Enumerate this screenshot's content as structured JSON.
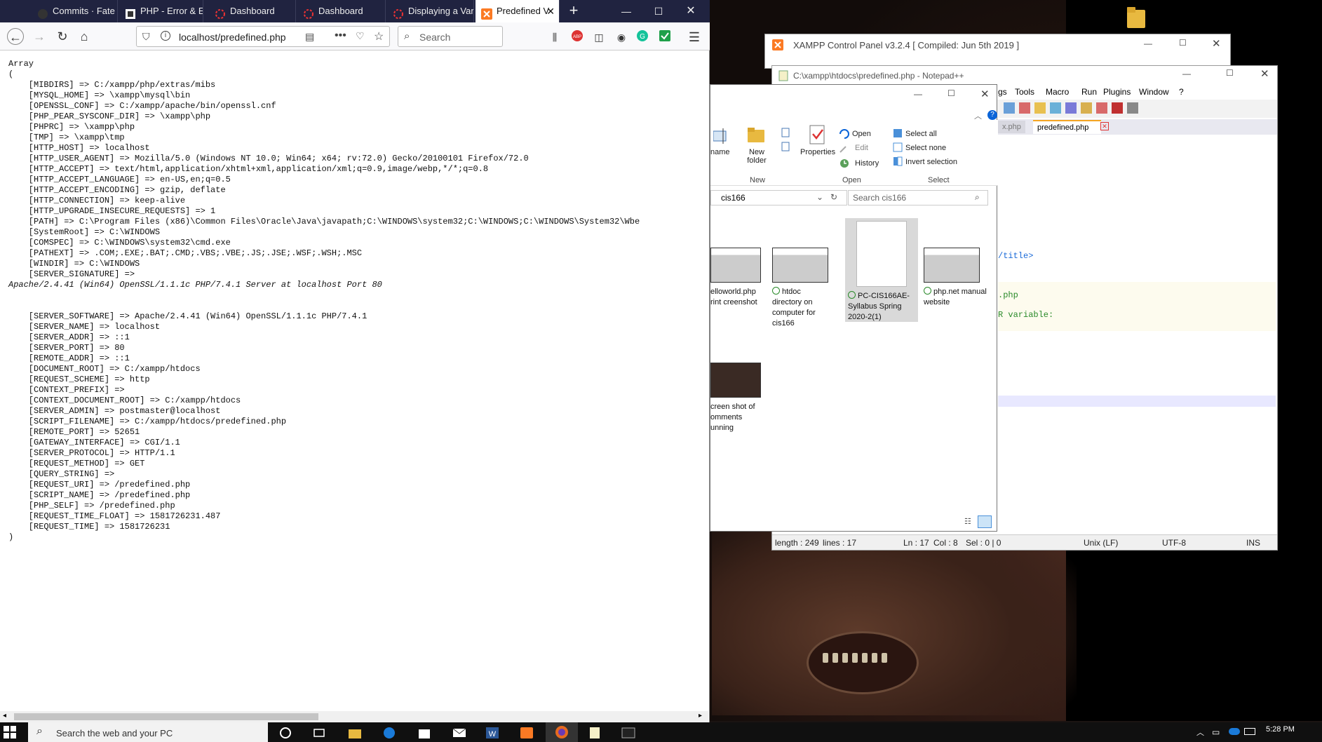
{
  "browser": {
    "tabs": [
      {
        "label": "Commits · Fate",
        "icon": "github-icon"
      },
      {
        "label": "PHP - Error & E",
        "icon": "page-icon"
      },
      {
        "label": "Dashboard",
        "icon": "dashboard-icon"
      },
      {
        "label": "Dashboard",
        "icon": "dashboard-icon"
      },
      {
        "label": "Displaying a Var",
        "icon": "dashboard-icon"
      },
      {
        "label": "Predefined V",
        "icon": "xampp-icon"
      }
    ],
    "url": "localhost/predefined.php",
    "search_placeholder": "Search",
    "content_lines": [
      "Array",
      "(",
      "    [MIBDIRS] => C:/xampp/php/extras/mibs",
      "    [MYSQL_HOME] => \\xampp\\mysql\\bin",
      "    [OPENSSL_CONF] => C:/xampp/apache/bin/openssl.cnf",
      "    [PHP_PEAR_SYSCONF_DIR] => \\xampp\\php",
      "    [PHPRC] => \\xampp\\php",
      "    [TMP] => \\xampp\\tmp",
      "    [HTTP_HOST] => localhost",
      "    [HTTP_USER_AGENT] => Mozilla/5.0 (Windows NT 10.0; Win64; x64; rv:72.0) Gecko/20100101 Firefox/72.0",
      "    [HTTP_ACCEPT] => text/html,application/xhtml+xml,application/xml;q=0.9,image/webp,*/*;q=0.8",
      "    [HTTP_ACCEPT_LANGUAGE] => en-US,en;q=0.5",
      "    [HTTP_ACCEPT_ENCODING] => gzip, deflate",
      "    [HTTP_CONNECTION] => keep-alive",
      "    [HTTP_UPGRADE_INSECURE_REQUESTS] => 1",
      "    [PATH] => C:\\Program Files (x86)\\Common Files\\Oracle\\Java\\javapath;C:\\WINDOWS\\system32;C:\\WINDOWS;C:\\WINDOWS\\System32\\Wbe",
      "    [SystemRoot] => C:\\WINDOWS",
      "    [COMSPEC] => C:\\WINDOWS\\system32\\cmd.exe",
      "    [PATHEXT] => .COM;.EXE;.BAT;.CMD;.VBS;.VBE;.JS;.JSE;.WSF;.WSH;.MSC",
      "    [WINDIR] => C:\\WINDOWS",
      "    [SERVER_SIGNATURE] =>",
      "Apache/2.4.41 (Win64) OpenSSL/1.1.1c PHP/7.4.1 Server at localhost Port 80",
      "",
      "",
      "    [SERVER_SOFTWARE] => Apache/2.4.41 (Win64) OpenSSL/1.1.1c PHP/7.4.1",
      "    [SERVER_NAME] => localhost",
      "    [SERVER_ADDR] => ::1",
      "    [SERVER_PORT] => 80",
      "    [REMOTE_ADDR] => ::1",
      "    [DOCUMENT_ROOT] => C:/xampp/htdocs",
      "    [REQUEST_SCHEME] => http",
      "    [CONTEXT_PREFIX] =>",
      "    [CONTEXT_DOCUMENT_ROOT] => C:/xampp/htdocs",
      "    [SERVER_ADMIN] => postmaster@localhost",
      "    [SCRIPT_FILENAME] => C:/xampp/htdocs/predefined.php",
      "    [REMOTE_PORT] => 52651",
      "    [GATEWAY_INTERFACE] => CGI/1.1",
      "    [SERVER_PROTOCOL] => HTTP/1.1",
      "    [REQUEST_METHOD] => GET",
      "    [QUERY_STRING] =>",
      "    [REQUEST_URI] => /predefined.php",
      "    [SCRIPT_NAME] => /predefined.php",
      "    [PHP_SELF] => /predefined.php",
      "    [REQUEST_TIME_FLOAT] => 1581726231.487",
      "    [REQUEST_TIME] => 1581726231",
      ")"
    ]
  },
  "xampp": {
    "title": "XAMPP Control Panel v3.2.4   [ Compiled: Jun 5th 2019 ]"
  },
  "notepad": {
    "title": "C:\\xampp\\htdocs\\predefined.php - Notepad++",
    "menu": [
      "gs",
      "Tools",
      "Macro",
      "Run",
      "Plugins",
      "Window",
      "?"
    ],
    "tabs": [
      "x.php",
      "predefined.php"
    ],
    "code_lines": [
      "/title>",
      ".php",
      "R variable:"
    ],
    "status": {
      "length": "length : 249",
      "lines": "lines : 17",
      "ln": "Ln : 17",
      "col": "Col : 8",
      "sel": "Sel : 0 | 0",
      "eol": "Unix (LF)",
      "enc": "UTF-8",
      "ins": "INS"
    }
  },
  "explorer": {
    "ribbon": {
      "rename": "name",
      "new_folder": "New folder",
      "group_new": "New",
      "properties": "Properties",
      "open": "Open",
      "edit": "Edit",
      "history": "History",
      "group_open": "Open",
      "select_all": "Select all",
      "select_none": "Select none",
      "invert_selection": "Invert selection",
      "group_select": "Select"
    },
    "address": "cis166",
    "search_placeholder": "Search cis166",
    "files": [
      {
        "name": "elloworld.php rint creenshot"
      },
      {
        "name": "htdoc directory on computer for cis166"
      },
      {
        "name": "PC-CIS166AE-Syllabus Spring 2020-2(1)"
      },
      {
        "name": "php.net manual website"
      },
      {
        "name": "creen shot of omments unning"
      }
    ]
  },
  "taskbar": {
    "search_placeholder": "Search the web and your PC",
    "time": "5:28 PM"
  },
  "colors": {
    "tabbar": "#202340",
    "taskbar": "#101010",
    "accent": "#0a64d8"
  }
}
